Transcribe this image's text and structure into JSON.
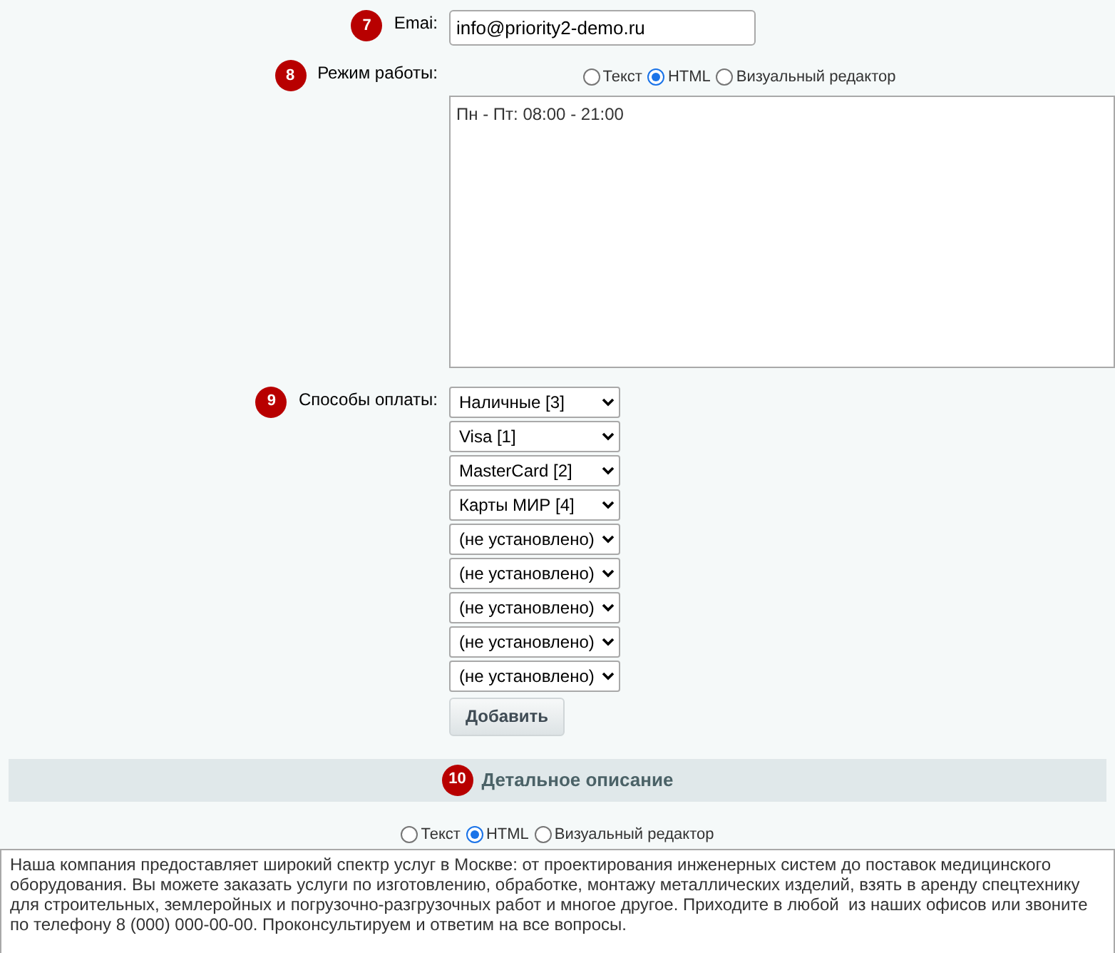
{
  "email": {
    "badge": "7",
    "label": "Emai:",
    "value": "info@priority2-demo.ru"
  },
  "schedule": {
    "badge": "8",
    "label": "Режим работы:",
    "modes": [
      {
        "label": "Текст",
        "selected": false
      },
      {
        "label": "HTML",
        "selected": true
      },
      {
        "label": "Визуальный редактор",
        "selected": false
      }
    ],
    "value": "Пн - Пт: 08:00 - 21:00"
  },
  "payment": {
    "badge": "9",
    "label": "Способы оплаты:",
    "selects": [
      {
        "value": "Наличные [3]"
      },
      {
        "value": "Visa [1]"
      },
      {
        "value": "MasterCard [2]"
      },
      {
        "value": "Карты МИР [4]"
      },
      {
        "value": "(не установлено)"
      },
      {
        "value": "(не установлено)"
      },
      {
        "value": "(не установлено)"
      },
      {
        "value": "(не установлено)"
      },
      {
        "value": "(не установлено)"
      }
    ],
    "add_button": "Добавить"
  },
  "description": {
    "badge": "10",
    "title": "Детальное описание",
    "modes": [
      {
        "label": "Текст",
        "selected": false
      },
      {
        "label": "HTML",
        "selected": true
      },
      {
        "label": "Визуальный редактор",
        "selected": false
      }
    ],
    "value": "Наша компания предоставляет широкий спектр услуг в Москве: от проектирования инженерных систем до поставок медицинского оборудования. Вы можете заказать услуги по изготовлению, обработке, монтажу металлических изделий, взять в аренду спецтехнику для строительных, землеройных и погрузочно-разгрузочных работ и многое другое. Приходите в любой  из наших офисов или звоните по телефону 8 (000) 000-00-00. Проконсультируем и ответим на все вопросы."
  }
}
